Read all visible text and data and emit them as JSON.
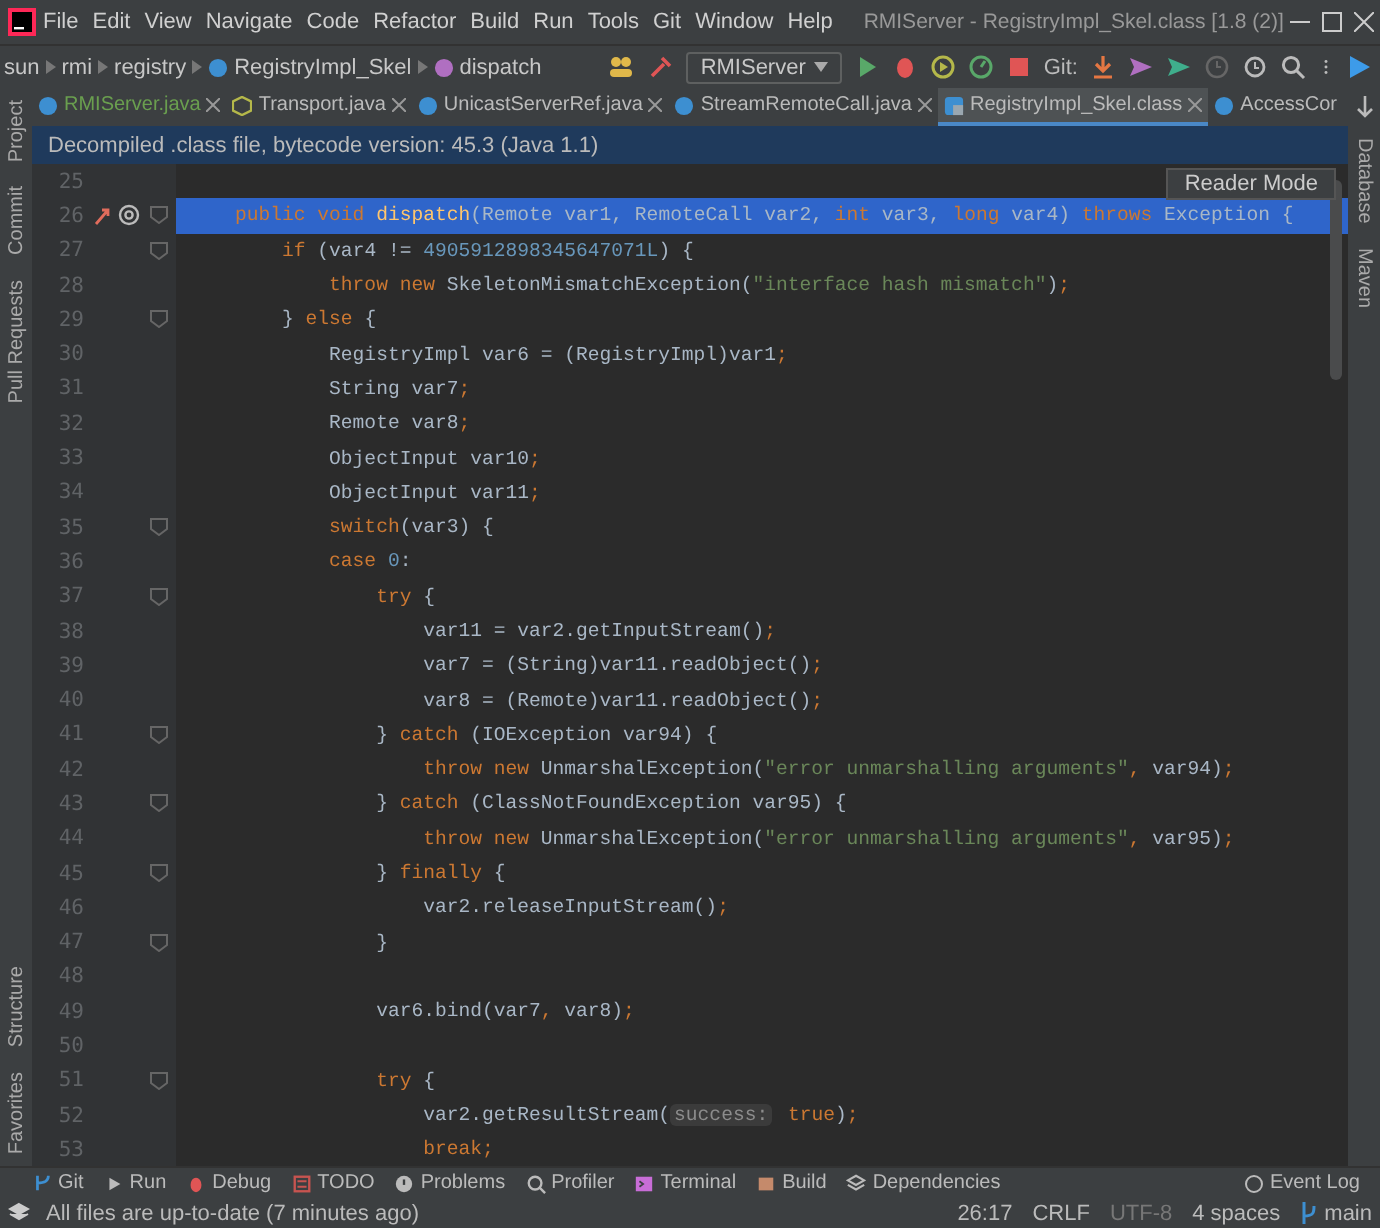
{
  "window": {
    "menus": [
      "File",
      "Edit",
      "View",
      "Navigate",
      "Code",
      "Refactor",
      "Build",
      "Run",
      "Tools",
      "Git",
      "Window",
      "Help"
    ],
    "title": "RMIServer - RegistryImpl_Skel.class [1.8 (2)]"
  },
  "toolbar": {
    "breadcrumbs": [
      {
        "label": "sun",
        "kind": "package"
      },
      {
        "label": "rmi",
        "kind": "package"
      },
      {
        "label": "registry",
        "kind": "package"
      },
      {
        "label": "RegistryImpl_Skel",
        "kind": "class"
      },
      {
        "label": "dispatch",
        "kind": "method"
      }
    ],
    "run_config": "RMIServer",
    "git_label": "Git:"
  },
  "tabs": [
    {
      "label": "RMIServer.java",
      "color": "#6a9f4f",
      "selected": false,
      "kind": "class"
    },
    {
      "label": "Transport.java",
      "color": "#bbbbbb",
      "selected": false,
      "kind": "interface"
    },
    {
      "label": "UnicastServerRef.java",
      "color": "#bbbbbb",
      "selected": false,
      "kind": "class"
    },
    {
      "label": "StreamRemoteCall.java",
      "color": "#bbbbbb",
      "selected": false,
      "kind": "class"
    },
    {
      "label": "RegistryImpl_Skel.class",
      "color": "#bbbbbb",
      "selected": true,
      "kind": "compiled"
    },
    {
      "label": "AccessCor",
      "color": "#bbbbbb",
      "selected": false,
      "kind": "class"
    }
  ],
  "left_panels_top": [
    "Project",
    "Commit",
    "Pull Requests"
  ],
  "left_panels_bottom": [
    "Structure",
    "Favorites"
  ],
  "right_panels": [
    "Database",
    "Maven"
  ],
  "banner": "Decompiled .class file, bytecode version: 45.3 (Java 1.1)",
  "tooltip": "Reader Mode",
  "code_lines": [
    {
      "number": "25",
      "selected": false,
      "markers": false,
      "foldable": false
    },
    {
      "number": "26",
      "selected": true,
      "markers": true,
      "foldable": true,
      "tokens": [
        {
          "kind": "kw",
          "text": "    public void "
        },
        {
          "kind": "fn",
          "text": "dispatch"
        },
        {
          "kind": "plain",
          "text": "(Remote var1, RemoteCall var2, "
        },
        {
          "kind": "kw",
          "text": "int"
        },
        {
          "kind": "plain",
          "text": " var3, "
        },
        {
          "kind": "kw",
          "text": "long"
        },
        {
          "kind": "plain",
          "text": " var4) "
        },
        {
          "kind": "kw",
          "text": "throws"
        },
        {
          "kind": "plain",
          "text": " Exception {"
        }
      ]
    },
    {
      "number": "27",
      "selected": false,
      "markers": false,
      "foldable": true,
      "tokens": [
        {
          "kind": "kw",
          "text": "        if"
        },
        {
          "kind": "plain",
          "text": " (var4 != "
        },
        {
          "kind": "num",
          "text": "4905912898345647071L"
        },
        {
          "kind": "plain",
          "text": ") {"
        }
      ]
    },
    {
      "number": "28",
      "selected": false,
      "markers": false,
      "foldable": false,
      "tokens": [
        {
          "kind": "kw",
          "text": "            throw new"
        },
        {
          "kind": "plain",
          "text": " SkeletonMismatchException("
        },
        {
          "kind": "str",
          "text": "\"interface hash mismatch\""
        },
        {
          "kind": "plain",
          "text": ")"
        },
        {
          "kind": "punct",
          "text": ";"
        }
      ]
    },
    {
      "number": "29",
      "selected": false,
      "markers": false,
      "foldable": true,
      "tokens": [
        {
          "kind": "plain",
          "text": "        } "
        },
        {
          "kind": "kw",
          "text": "else"
        },
        {
          "kind": "plain",
          "text": " {"
        }
      ]
    },
    {
      "number": "30",
      "selected": false,
      "markers": false,
      "foldable": false,
      "tokens": [
        {
          "kind": "plain",
          "text": "            RegistryImpl var6 = (RegistryImpl)var1"
        },
        {
          "kind": "punct",
          "text": ";"
        }
      ]
    },
    {
      "number": "31",
      "selected": false,
      "markers": false,
      "foldable": false,
      "tokens": [
        {
          "kind": "plain",
          "text": "            String var7"
        },
        {
          "kind": "punct",
          "text": ";"
        }
      ]
    },
    {
      "number": "32",
      "selected": false,
      "markers": false,
      "foldable": false,
      "tokens": [
        {
          "kind": "plain",
          "text": "            Remote var8"
        },
        {
          "kind": "punct",
          "text": ";"
        }
      ]
    },
    {
      "number": "33",
      "selected": false,
      "markers": false,
      "foldable": false,
      "tokens": [
        {
          "kind": "plain",
          "text": "            ObjectInput var10"
        },
        {
          "kind": "punct",
          "text": ";"
        }
      ]
    },
    {
      "number": "34",
      "selected": false,
      "markers": false,
      "foldable": false,
      "tokens": [
        {
          "kind": "plain",
          "text": "            ObjectInput var11"
        },
        {
          "kind": "punct",
          "text": ";"
        }
      ]
    },
    {
      "number": "35",
      "selected": false,
      "markers": false,
      "foldable": true,
      "tokens": [
        {
          "kind": "kw",
          "text": "            switch"
        },
        {
          "kind": "plain",
          "text": "(var3) {"
        }
      ]
    },
    {
      "number": "36",
      "selected": false,
      "markers": false,
      "foldable": false,
      "tokens": [
        {
          "kind": "kw",
          "text": "            case "
        },
        {
          "kind": "num",
          "text": "0"
        },
        {
          "kind": "plain",
          "text": ":"
        }
      ]
    },
    {
      "number": "37",
      "selected": false,
      "markers": false,
      "foldable": true,
      "tokens": [
        {
          "kind": "kw",
          "text": "                try"
        },
        {
          "kind": "plain",
          "text": " {"
        }
      ]
    },
    {
      "number": "38",
      "selected": false,
      "markers": false,
      "foldable": false,
      "tokens": [
        {
          "kind": "plain",
          "text": "                    var11 = var2.getInputStream()"
        },
        {
          "kind": "punct",
          "text": ";"
        }
      ]
    },
    {
      "number": "39",
      "selected": false,
      "markers": false,
      "foldable": false,
      "tokens": [
        {
          "kind": "plain",
          "text": "                    var7 = (String)var11.readObject()"
        },
        {
          "kind": "punct",
          "text": ";"
        }
      ]
    },
    {
      "number": "40",
      "selected": false,
      "markers": false,
      "foldable": false,
      "tokens": [
        {
          "kind": "plain",
          "text": "                    var8 = (Remote)var11.readObject()"
        },
        {
          "kind": "punct",
          "text": ";"
        }
      ]
    },
    {
      "number": "41",
      "selected": false,
      "markers": false,
      "foldable": true,
      "tokens": [
        {
          "kind": "plain",
          "text": "                } "
        },
        {
          "kind": "kw",
          "text": "catch"
        },
        {
          "kind": "plain",
          "text": " (IOException var94) {"
        }
      ]
    },
    {
      "number": "42",
      "selected": false,
      "markers": false,
      "foldable": false,
      "tokens": [
        {
          "kind": "kw",
          "text": "                    throw new"
        },
        {
          "kind": "plain",
          "text": " UnmarshalException("
        },
        {
          "kind": "str",
          "text": "\"error unmarshalling arguments\""
        },
        {
          "kind": "punct",
          "text": ","
        },
        {
          "kind": "plain",
          "text": " var94)"
        },
        {
          "kind": "punct",
          "text": ";"
        }
      ]
    },
    {
      "number": "43",
      "selected": false,
      "markers": false,
      "foldable": true,
      "tokens": [
        {
          "kind": "plain",
          "text": "                } "
        },
        {
          "kind": "kw",
          "text": "catch"
        },
        {
          "kind": "plain",
          "text": " (ClassNotFoundException var95) {"
        }
      ]
    },
    {
      "number": "44",
      "selected": false,
      "markers": false,
      "foldable": false,
      "tokens": [
        {
          "kind": "kw",
          "text": "                    throw new"
        },
        {
          "kind": "plain",
          "text": " UnmarshalException("
        },
        {
          "kind": "str",
          "text": "\"error unmarshalling arguments\""
        },
        {
          "kind": "punct",
          "text": ","
        },
        {
          "kind": "plain",
          "text": " var95)"
        },
        {
          "kind": "punct",
          "text": ";"
        }
      ]
    },
    {
      "number": "45",
      "selected": false,
      "markers": false,
      "foldable": true,
      "tokens": [
        {
          "kind": "plain",
          "text": "                } "
        },
        {
          "kind": "kw",
          "text": "finally"
        },
        {
          "kind": "plain",
          "text": " {"
        }
      ]
    },
    {
      "number": "46",
      "selected": false,
      "markers": false,
      "foldable": false,
      "tokens": [
        {
          "kind": "plain",
          "text": "                    var2.releaseInputStream()"
        },
        {
          "kind": "punct",
          "text": ";"
        }
      ]
    },
    {
      "number": "47",
      "selected": false,
      "markers": false,
      "foldable": true,
      "tokens": [
        {
          "kind": "plain",
          "text": "                }"
        }
      ]
    },
    {
      "number": "48",
      "selected": false,
      "markers": false,
      "foldable": false
    },
    {
      "number": "49",
      "selected": false,
      "markers": false,
      "foldable": false,
      "tokens": [
        {
          "kind": "plain",
          "text": "                var6.bind(var7"
        },
        {
          "kind": "punct",
          "text": ","
        },
        {
          "kind": "plain",
          "text": " var8)"
        },
        {
          "kind": "punct",
          "text": ";"
        }
      ]
    },
    {
      "number": "50",
      "selected": false,
      "markers": false,
      "foldable": false
    },
    {
      "number": "51",
      "selected": false,
      "markers": false,
      "foldable": true,
      "tokens": [
        {
          "kind": "kw",
          "text": "                try"
        },
        {
          "kind": "plain",
          "text": " {"
        }
      ]
    },
    {
      "number": "52",
      "selected": false,
      "markers": false,
      "foldable": false,
      "tokens": [
        {
          "kind": "plain",
          "text": "                    var2.getResultStream("
        },
        {
          "kind": "hint",
          "text": "success:"
        },
        {
          "kind": "kw",
          "text": " true"
        },
        {
          "kind": "plain",
          "text": ")"
        },
        {
          "kind": "punct",
          "text": ";"
        }
      ]
    },
    {
      "number": "53",
      "selected": false,
      "markers": false,
      "foldable": false,
      "tokens": [
        {
          "kind": "kw",
          "text": "                    break"
        },
        {
          "kind": "punct",
          "text": ";"
        }
      ]
    }
  ],
  "tool_windows": [
    {
      "label": "Git",
      "kind": "git"
    },
    {
      "label": "Run",
      "kind": "run"
    },
    {
      "label": "Debug",
      "kind": "debug"
    },
    {
      "label": "TODO",
      "kind": "todo"
    },
    {
      "label": "Problems",
      "kind": "problems"
    },
    {
      "label": "Profiler",
      "kind": "profiler"
    },
    {
      "label": "Terminal",
      "kind": "terminal"
    },
    {
      "label": "Build",
      "kind": "build"
    },
    {
      "label": "Dependencies",
      "kind": "deps"
    }
  ],
  "event_log": "Event Log",
  "status_bar": {
    "message": "All files are up-to-date (7 minutes ago)",
    "items": [
      {
        "text": "26:17",
        "disabled": false
      },
      {
        "text": "CRLF",
        "disabled": false
      },
      {
        "text": "UTF-8",
        "disabled": true
      },
      {
        "text": "4 spaces",
        "disabled": false
      }
    ],
    "branch": "main"
  }
}
